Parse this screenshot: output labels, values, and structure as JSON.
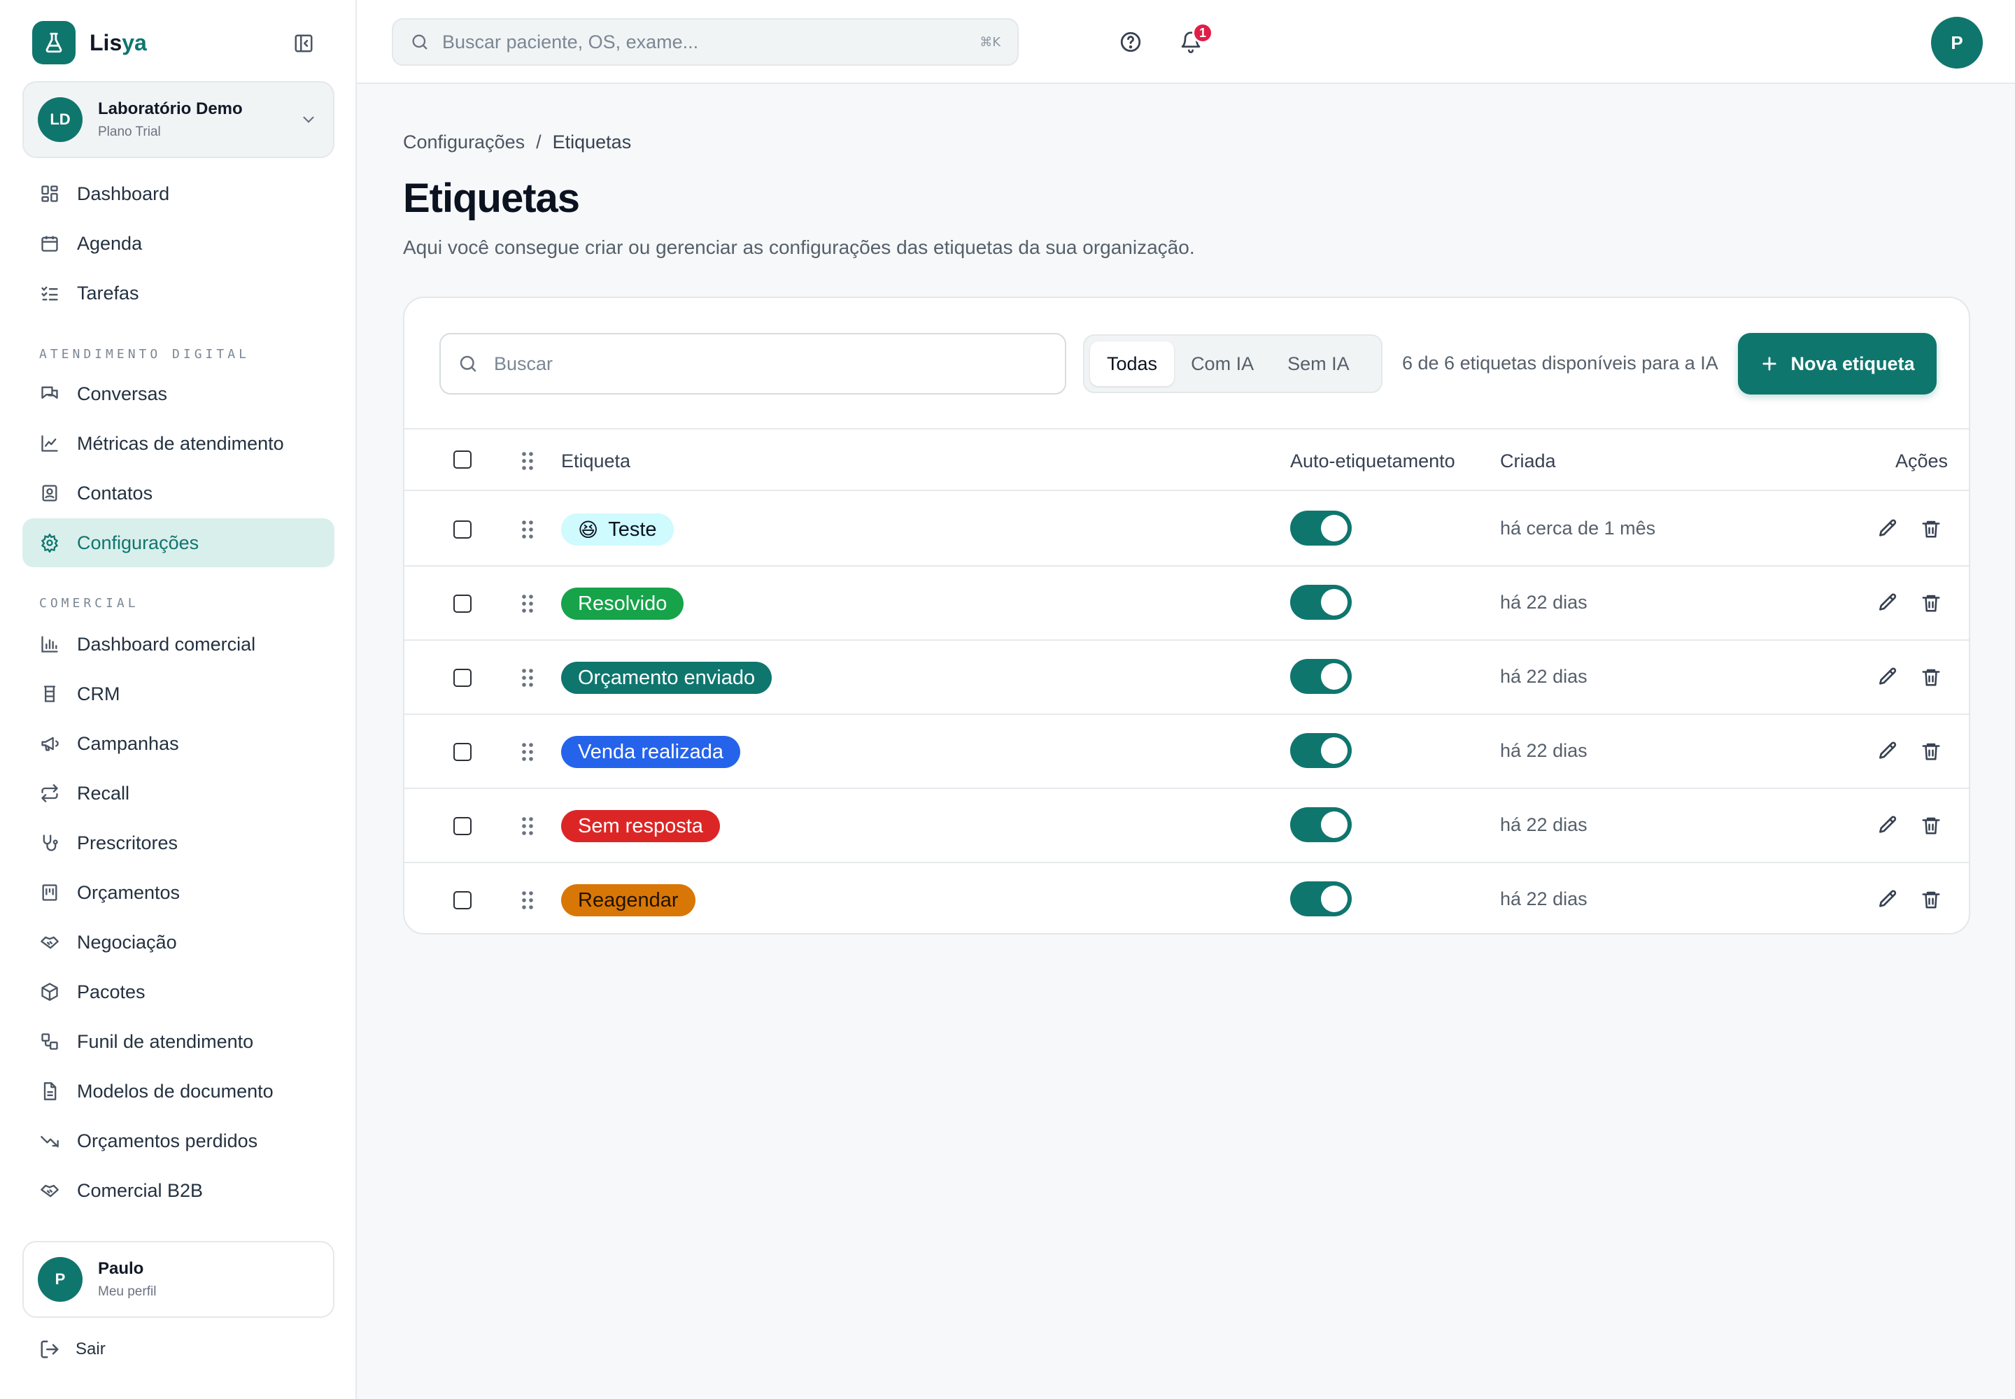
{
  "brand": {
    "name_main": "Lis",
    "name_accent": "ya",
    "logo_icon": "flask-icon"
  },
  "org": {
    "initials": "LD",
    "name": "Laboratório Demo",
    "plan": "Plano Trial"
  },
  "nav": {
    "main": [
      {
        "label": "Dashboard",
        "icon": "dashboard-icon"
      },
      {
        "label": "Agenda",
        "icon": "calendar-icon"
      },
      {
        "label": "Tarefas",
        "icon": "tasks-icon"
      }
    ],
    "section_digital": "ATENDIMENTO DIGITAL",
    "digital": [
      {
        "label": "Conversas",
        "icon": "chat-icon"
      },
      {
        "label": "Métricas de atendimento",
        "icon": "chart-line-icon"
      },
      {
        "label": "Contatos",
        "icon": "contacts-icon"
      },
      {
        "label": "Configurações",
        "icon": "gear-icon",
        "active": true
      }
    ],
    "section_comercial": "COMERCIAL",
    "comercial": [
      {
        "label": "Dashboard comercial",
        "icon": "bar-chart-icon"
      },
      {
        "label": "CRM",
        "icon": "crm-icon"
      },
      {
        "label": "Campanhas",
        "icon": "megaphone-icon"
      },
      {
        "label": "Recall",
        "icon": "repeat-icon"
      },
      {
        "label": "Prescritores",
        "icon": "stethoscope-icon"
      },
      {
        "label": "Orçamentos",
        "icon": "receipt-icon"
      },
      {
        "label": "Negociação",
        "icon": "handshake-icon"
      },
      {
        "label": "Pacotes",
        "icon": "package-icon"
      },
      {
        "label": "Funil de atendimento",
        "icon": "funnel-icon"
      },
      {
        "label": "Modelos de documento",
        "icon": "document-icon"
      },
      {
        "label": "Orçamentos perdidos",
        "icon": "trending-down-icon"
      },
      {
        "label": "Comercial B2B",
        "icon": "handshake-icon"
      }
    ]
  },
  "profile": {
    "initial": "P",
    "name": "Paulo",
    "subtitle": "Meu perfil"
  },
  "logout_label": "Sair",
  "topbar": {
    "search_placeholder": "Buscar paciente, OS, exame...",
    "shortcut": "⌘K",
    "notifications_count": "1",
    "avatar_initial": "P"
  },
  "breadcrumb": {
    "parent": "Configurações",
    "separator": "/",
    "current": "Etiquetas"
  },
  "page": {
    "title": "Etiquetas",
    "description": "Aqui você consegue criar ou gerenciar as configurações das etiquetas da sua organização."
  },
  "toolbar": {
    "search_placeholder": "Buscar",
    "filters": [
      "Todas",
      "Com IA",
      "Sem IA"
    ],
    "active_filter": "Todas",
    "available_text": "6 de 6 etiquetas disponíveis para a IA",
    "new_button": "Nova etiqueta"
  },
  "table": {
    "headers": {
      "tag": "Etiqueta",
      "auto": "Auto-etiquetamento",
      "created": "Criada",
      "actions": "Ações"
    },
    "rows": [
      {
        "emoji": "😆",
        "name": "Teste",
        "bg": "#cffafe",
        "fg": "#0b1320",
        "auto": true,
        "created": "há cerca de 1 mês"
      },
      {
        "emoji": "",
        "name": "Resolvido",
        "bg": "#16a34a",
        "fg": "#ffffff",
        "auto": true,
        "created": "há 22 dias"
      },
      {
        "emoji": "",
        "name": "Orçamento enviado",
        "bg": "#0f766e",
        "fg": "#ffffff",
        "auto": true,
        "created": "há 22 dias"
      },
      {
        "emoji": "",
        "name": "Venda realizada",
        "bg": "#2563eb",
        "fg": "#ffffff",
        "auto": true,
        "created": "há 22 dias"
      },
      {
        "emoji": "",
        "name": "Sem resposta",
        "bg": "#dc2626",
        "fg": "#ffffff",
        "auto": true,
        "created": "há 22 dias"
      },
      {
        "emoji": "",
        "name": "Reagendar",
        "bg": "#d97706",
        "fg": "#1f1300",
        "auto": true,
        "created": "há 22 dias"
      }
    ]
  },
  "colors": {
    "accent": "#0f766e",
    "accent_soft": "#d9efec",
    "badge": "#e11d48"
  }
}
